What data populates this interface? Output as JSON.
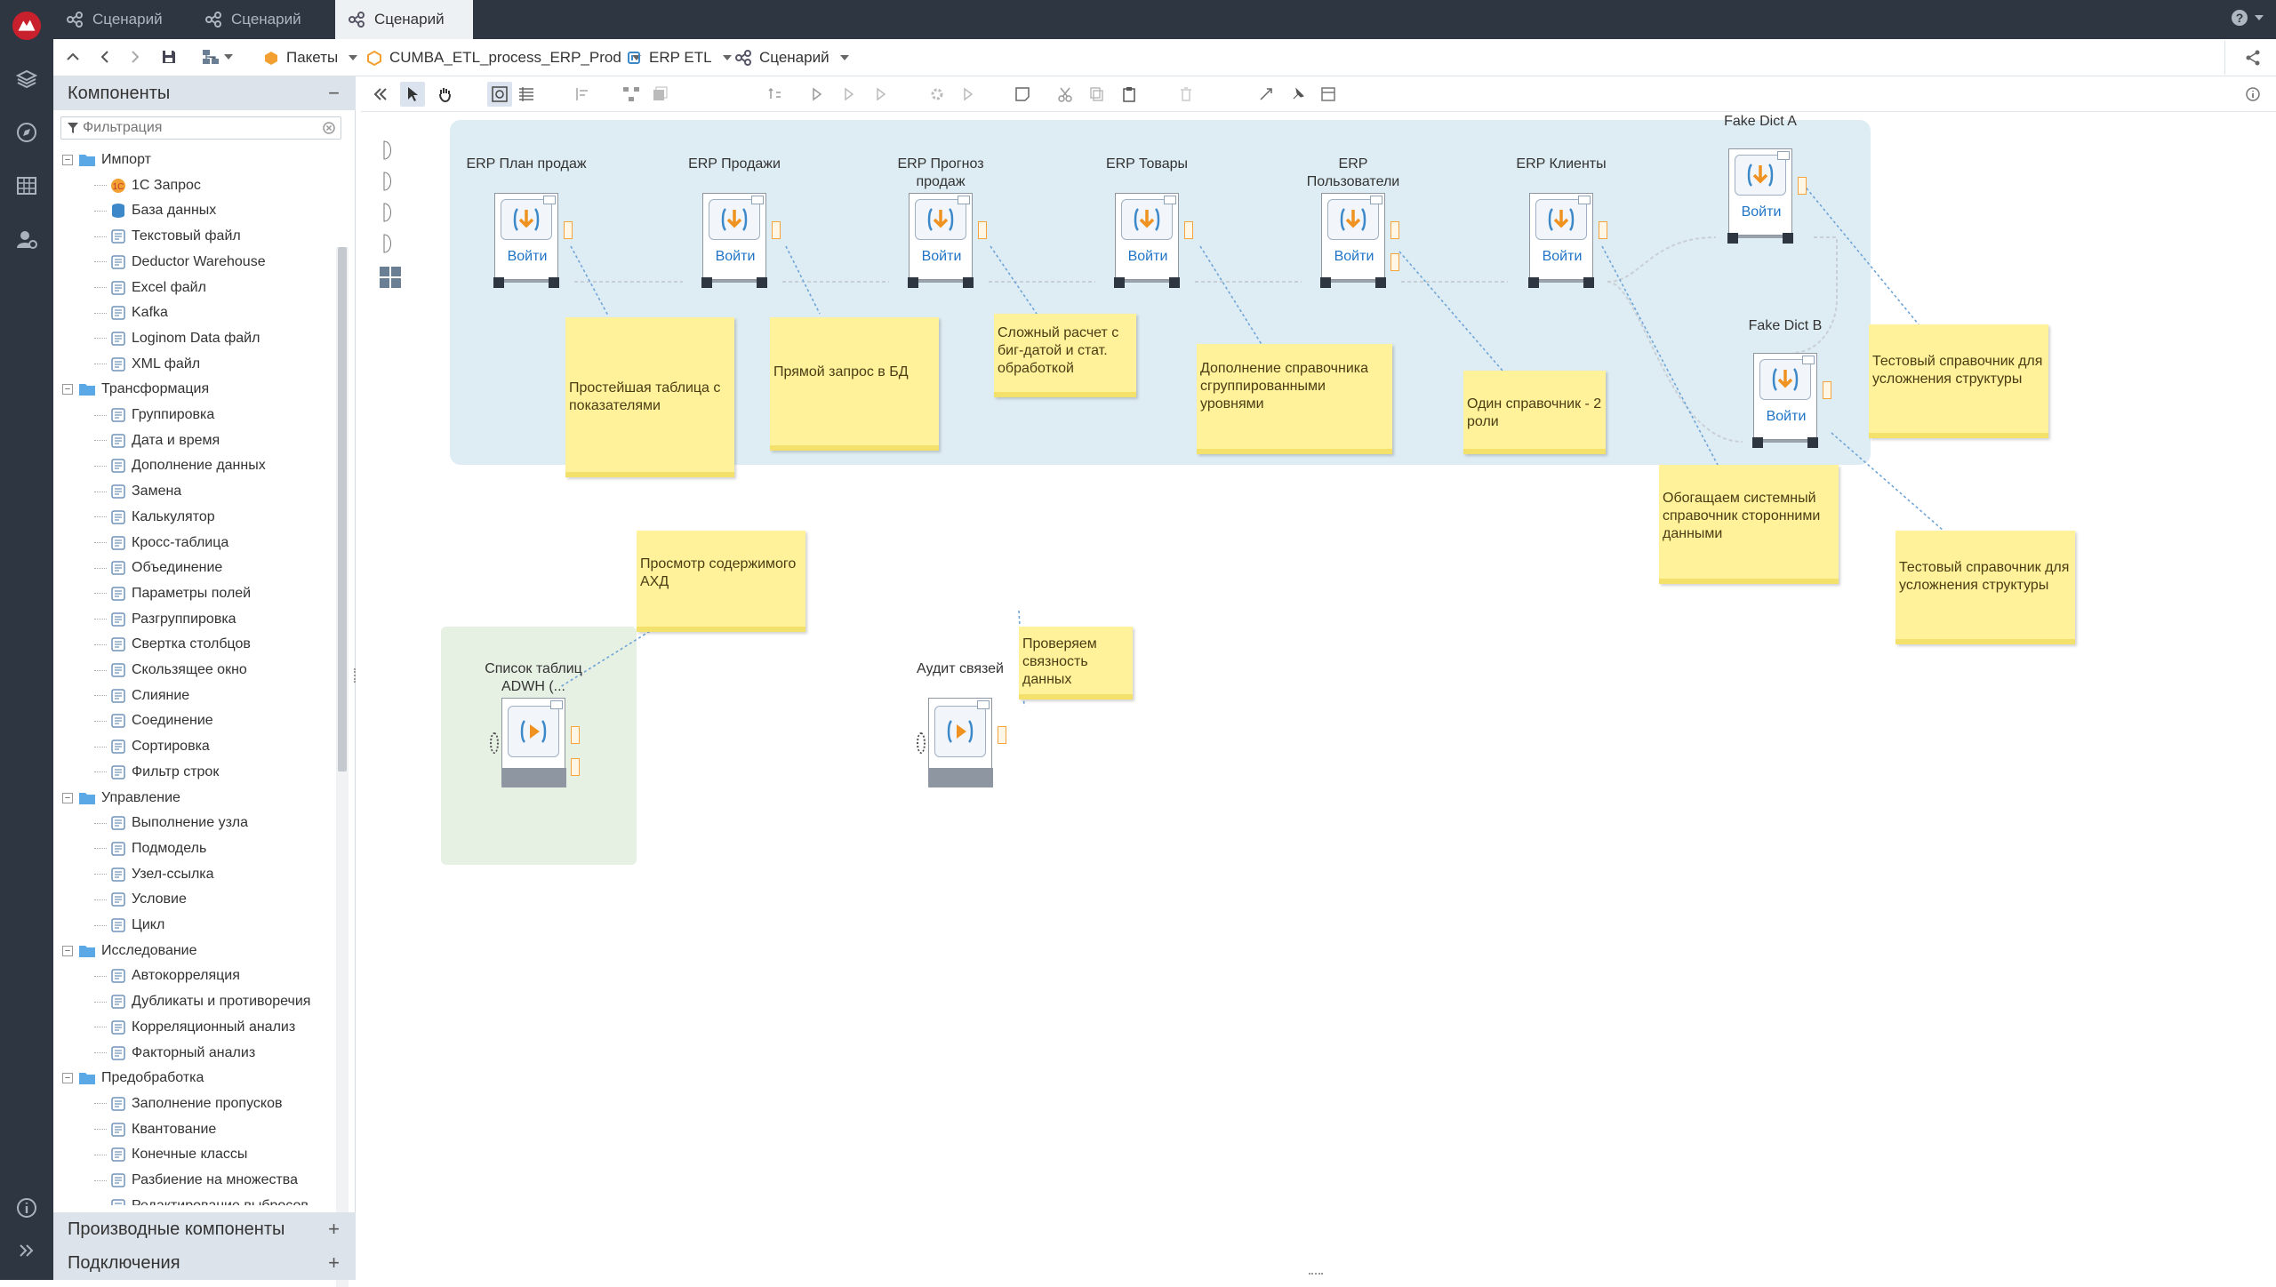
{
  "tabs": [
    {
      "label": "Сценарий",
      "active": false
    },
    {
      "label": "Сценарий",
      "active": false
    },
    {
      "label": "Сценарий",
      "active": true
    }
  ],
  "help_label": "?",
  "breadcrumbs": [
    {
      "label": "Пакеты"
    },
    {
      "label": "CUMBA_ETL_process_ERP_Prod"
    },
    {
      "label": "ERP ETL"
    },
    {
      "label": "Сценарий"
    }
  ],
  "panel": {
    "title": "Компоненты",
    "filter_placeholder": "Фильтрация",
    "groups": [
      {
        "label": "Импорт",
        "items": [
          "1С Запрос",
          "База данных",
          "Текстовый файл",
          "Deductor Warehouse",
          "Excel файл",
          "Kafka",
          "Loginom Data файл",
          "XML файл"
        ]
      },
      {
        "label": "Трансформация",
        "items": [
          "Группировка",
          "Дата и время",
          "Дополнение данных",
          "Замена",
          "Калькулятор",
          "Кросс-таблица",
          "Объединение",
          "Параметры полей",
          "Разгруппировка",
          "Свертка столбцов",
          "Скользящее окно",
          "Слияние",
          "Соединение",
          "Сортировка",
          "Фильтр строк"
        ]
      },
      {
        "label": "Управление",
        "items": [
          "Выполнение узла",
          "Подмодель",
          "Узел-ссылка",
          "Условие",
          "Цикл"
        ]
      },
      {
        "label": "Исследование",
        "items": [
          "Автокорреляция",
          "Дубликаты и противоречия",
          "Корреляционный анализ",
          "Факторный анализ"
        ]
      },
      {
        "label": "Предобработка",
        "items": [
          "Заполнение пропусков",
          "Квантование",
          "Конечные классы",
          "Разбиение на множества",
          "Редактирование выбросов"
        ]
      }
    ],
    "derived_title": "Производные компоненты",
    "connections_title": "Подключения"
  },
  "nodes": [
    {
      "title": "ERP План продаж",
      "label": "Войти"
    },
    {
      "title": "ERP Продажи",
      "label": "Войти"
    },
    {
      "title": "ERP Прогноз продаж",
      "label": "Войти"
    },
    {
      "title": "ERP Товары",
      "label": "Войти"
    },
    {
      "title": "ERP Пользователи",
      "label": "Войти"
    },
    {
      "title": "ERP Клиенты",
      "label": "Войти"
    },
    {
      "title": "Fake Dict A",
      "label": "Войти"
    },
    {
      "title": "Fake Dict B",
      "label": "Войти"
    },
    {
      "title": "Список таблиц ADWH (...",
      "label": ""
    },
    {
      "title": "Аудит связей",
      "label": ""
    }
  ],
  "stickies": [
    "Простейшая таблица с показателями",
    "Прямой запрос в БД",
    "Сложный расчет с биг-датой и стат. обработкой",
    "Дополнение справочника сгруппированными уровнями",
    "Один справочник - 2 роли",
    "Тестовый справочник для усложнения структуры",
    "Обогащаем системный справочник сторонними данными",
    "Тестовый справочник для усложнения структуры",
    "Просмотр содержимого АХД",
    "Проверяем связность данных"
  ],
  "colors": {
    "rail": "#2e3642",
    "group_blue": "#deedf3",
    "group_green": "#e6f0e3",
    "sticky": "#fff29a",
    "accent": "#1f74c6",
    "port": "#f4a43a"
  }
}
